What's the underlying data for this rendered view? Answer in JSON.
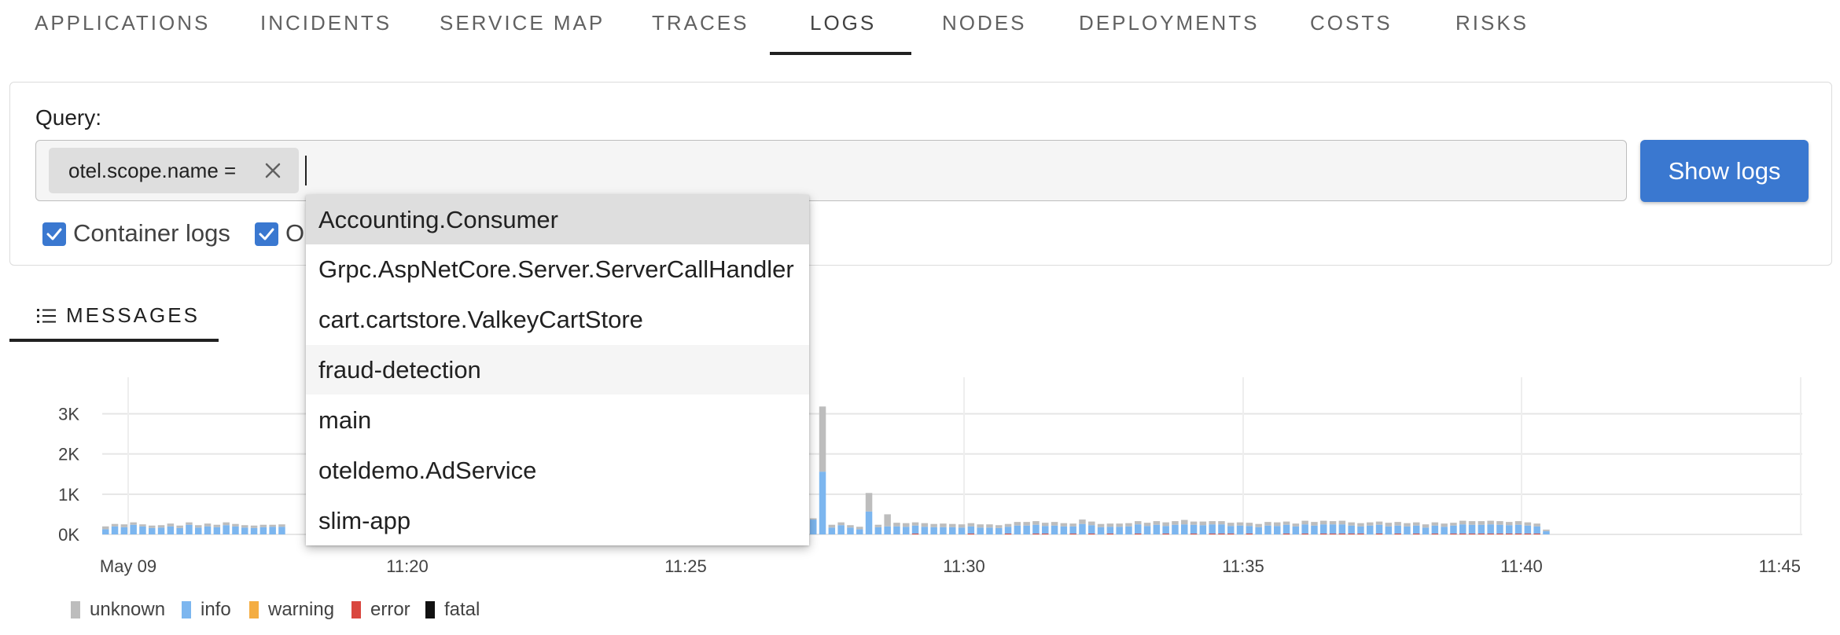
{
  "tabs": [
    {
      "label": "APPLICATIONS",
      "active": false
    },
    {
      "label": "INCIDENTS",
      "active": false
    },
    {
      "label": "SERVICE MAP",
      "active": false
    },
    {
      "label": "TRACES",
      "active": false
    },
    {
      "label": "LOGS",
      "active": true
    },
    {
      "label": "NODES",
      "active": false
    },
    {
      "label": "DEPLOYMENTS",
      "active": false
    },
    {
      "label": "COSTS",
      "active": false
    },
    {
      "label": "RISKS",
      "active": false
    }
  ],
  "query": {
    "label": "Query:",
    "chip_label": "otel.scope.name =",
    "input_value": "",
    "show_logs_label": "Show logs",
    "checkboxes": [
      {
        "label": "Container logs",
        "checked": true
      },
      {
        "label": "Op",
        "checked": true
      }
    ]
  },
  "dropdown": {
    "options": [
      "Accounting.Consumer",
      "Grpc.AspNetCore.Server.ServerCallHandler",
      "cart.cartstore.ValkeyCartStore",
      "fraud-detection",
      "main",
      "oteldemo.AdService",
      "slim-app"
    ],
    "selected_index": 0,
    "hover_index": 3
  },
  "messages_tab": {
    "label": "MESSAGES",
    "icon": "list-icon"
  },
  "colors": {
    "accent": "#3a78d0",
    "unknown": "#bdbdbd",
    "info": "#7cb6ef",
    "warning": "#f4ad42",
    "error": "#d9473f",
    "fatal": "#111111"
  },
  "chart_data": {
    "type": "bar",
    "stacked": true,
    "y_ticks": [
      "0K",
      "1K",
      "2K",
      "3K"
    ],
    "ylim": [
      0,
      3400
    ],
    "x_ticks": [
      {
        "label": "May 09",
        "t": "11:15"
      },
      {
        "label": "11:20",
        "t": "11:20"
      },
      {
        "label": "11:25",
        "t": "11:25"
      },
      {
        "label": "11:30",
        "t": "11:30"
      },
      {
        "label": "11:35",
        "t": "11:35"
      },
      {
        "label": "11:40",
        "t": "11:40"
      },
      {
        "label": "11:45",
        "t": "11:45"
      }
    ],
    "interval_seconds": 15,
    "start_time": "11:14",
    "series": [
      {
        "name": "unknown",
        "values": [
          40,
          60,
          70,
          70,
          60,
          60,
          60,
          60,
          70,
          60,
          60,
          70,
          80,
          60,
          60,
          60,
          50,
          60,
          70,
          70,
          80,
          60,
          60,
          60,
          60,
          60,
          60,
          60,
          60,
          60,
          60,
          60,
          60,
          60,
          60,
          60,
          60,
          60,
          60,
          60,
          60,
          60,
          60,
          60,
          60,
          60,
          60,
          60,
          60,
          60,
          60,
          60,
          60,
          60,
          60,
          60,
          60,
          60,
          60,
          60,
          60,
          60,
          60,
          60,
          60,
          60,
          60,
          60,
          60,
          60,
          60,
          60,
          60,
          60,
          60,
          60,
          60,
          60,
          60,
          60,
          60,
          60,
          60,
          60,
          60,
          60,
          60,
          60,
          60,
          60,
          60,
          60,
          60,
          60,
          60,
          60,
          60,
          60,
          60,
          60,
          60,
          60,
          60,
          60,
          60,
          60,
          60,
          60,
          60,
          60,
          60,
          60,
          60,
          60,
          60,
          60,
          60,
          60,
          60,
          60,
          60,
          60,
          60,
          60,
          60,
          60,
          60,
          60,
          60,
          60,
          60,
          60,
          60,
          60,
          60,
          60,
          60,
          60,
          60,
          60,
          60,
          60,
          60,
          60,
          60,
          60,
          60,
          60,
          60,
          60,
          60,
          60,
          60,
          60,
          60,
          60,
          60,
          60,
          60,
          60,
          60,
          60,
          60,
          60,
          60,
          60,
          60,
          60,
          60,
          60,
          60,
          60,
          60,
          60,
          60,
          60,
          60,
          60,
          60,
          60,
          60,
          60,
          60,
          60,
          60
        ]
      },
      {
        "name": "info",
        "values": [
          120,
          200,
          170,
          230,
          200,
          150,
          180,
          210,
          150,
          240,
          170,
          190,
          170,
          230,
          200,
          170,
          150,
          170,
          170,
          170,
          170,
          170,
          170,
          170,
          170,
          170,
          170,
          170,
          170,
          170,
          170,
          170,
          170,
          170,
          170,
          170,
          170,
          170,
          170,
          170,
          170,
          170,
          170,
          170,
          170,
          170,
          170,
          170,
          170,
          170,
          170,
          170,
          170,
          170,
          170,
          170,
          170,
          170,
          170,
          170,
          170,
          170,
          170,
          170,
          170,
          170,
          170,
          170,
          170,
          170,
          170,
          170,
          170,
          170,
          170,
          170,
          170,
          170,
          170,
          170,
          170,
          170,
          170,
          170,
          170,
          170,
          170,
          170,
          170,
          170,
          170,
          170,
          170,
          170,
          170,
          170,
          170,
          170,
          170,
          170,
          170,
          170,
          170,
          170,
          170,
          170,
          170,
          170,
          170,
          170,
          170,
          170,
          170,
          170,
          170,
          170,
          170,
          170,
          170,
          170,
          170,
          170,
          170,
          170,
          170,
          170,
          170,
          170,
          170,
          170,
          170,
          170,
          170,
          170,
          170,
          170,
          170,
          170,
          170,
          170,
          170,
          170,
          170,
          170,
          170,
          170,
          170,
          170,
          170,
          170,
          170,
          170,
          170,
          170,
          170,
          170,
          170,
          170,
          170,
          170,
          170,
          170,
          170,
          170,
          170,
          170,
          170,
          170,
          170,
          170,
          170,
          170,
          170,
          170,
          170,
          170,
          170,
          170,
          170,
          170,
          170,
          170,
          170,
          170,
          170
        ]
      }
    ],
    "visible_bars": {
      "first_x_label": "May 09",
      "unknown": [
        70,
        60,
        70,
        60,
        50,
        60,
        60,
        70,
        60,
        60,
        60,
        70,
        60,
        70,
        60,
        60,
        60,
        60,
        50,
        60
      ],
      "info": [
        130,
        200,
        180,
        240,
        200,
        160,
        170,
        200,
        160,
        240,
        170,
        200,
        180,
        230,
        200,
        170,
        160,
        180,
        190,
        190
      ]
    },
    "right_bars": {
      "unknown": [
        30,
        1620,
        70,
        70,
        60,
        60,
        460,
        60,
        300,
        90,
        90,
        80,
        90,
        80,
        90,
        80,
        80,
        80,
        80,
        80,
        70,
        70,
        90,
        90,
        90,
        80,
        90,
        80,
        70,
        110,
        90,
        80,
        80,
        80,
        80,
        80,
        80,
        90,
        90,
        90,
        110,
        80,
        90,
        80,
        80,
        80,
        80,
        80,
        80,
        90,
        90,
        80,
        70,
        90,
        90,
        90,
        80,
        90,
        80,
        80,
        80,
        80,
        90,
        90,
        80,
        80,
        80,
        80,
        80,
        70,
        90,
        90,
        90,
        90,
        90,
        80,
        90,
        80,
        70,
        40
      ],
      "info": [
        370,
        1560,
        170,
        230,
        170,
        130,
        570,
        180,
        200,
        200,
        190,
        200,
        190,
        180,
        180,
        180,
        170,
        180,
        170,
        170,
        160,
        170,
        220,
        220,
        220,
        190,
        220,
        200,
        180,
        260,
        210,
        180,
        170,
        190,
        200,
        230,
        210,
        240,
        190,
        240,
        250,
        220,
        230,
        230,
        230,
        190,
        220,
        190,
        180,
        220,
        210,
        220,
        200,
        230,
        220,
        230,
        230,
        230,
        200,
        180,
        220,
        220,
        200,
        200,
        200,
        200,
        170,
        200,
        190,
        200,
        230,
        220,
        220,
        230,
        220,
        210,
        220,
        200,
        180,
        80
      ],
      "error": [
        0,
        0,
        0,
        0,
        0,
        0,
        0,
        0,
        0,
        0,
        0,
        20,
        0,
        0,
        0,
        0,
        0,
        20,
        0,
        0,
        0,
        20,
        0,
        0,
        20,
        20,
        0,
        0,
        20,
        0,
        20,
        0,
        20,
        0,
        0,
        20,
        0,
        0,
        20,
        0,
        0,
        20,
        0,
        20,
        20,
        20,
        0,
        20,
        0,
        0,
        0,
        20,
        0,
        20,
        0,
        20,
        20,
        20,
        20,
        20,
        0,
        20,
        0,
        20,
        0,
        20,
        0,
        20,
        0,
        20,
        20,
        20,
        20,
        20,
        20,
        20,
        20,
        20,
        20,
        0
      ]
    },
    "legend": [
      {
        "name": "unknown"
      },
      {
        "name": "info"
      },
      {
        "name": "warning"
      },
      {
        "name": "error"
      },
      {
        "name": "fatal"
      }
    ]
  }
}
